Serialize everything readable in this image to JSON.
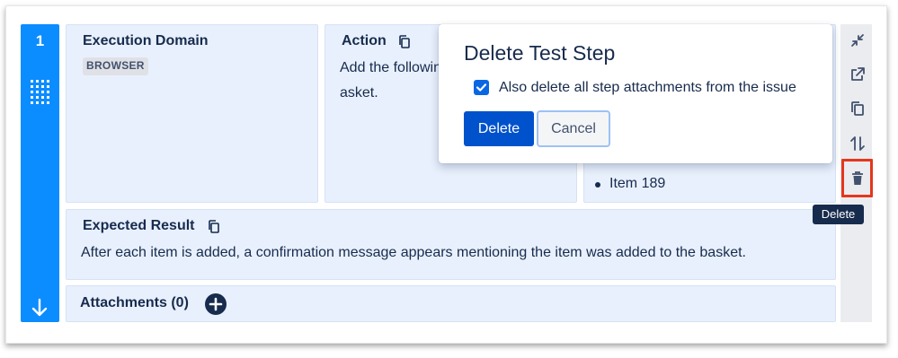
{
  "step": {
    "number": "1",
    "grid_icon": "grid-icon",
    "move_down_icon": "arrow-down-icon"
  },
  "execution_domain": {
    "title": "Execution Domain",
    "badge": "BROWSER"
  },
  "action": {
    "title": "Action",
    "text_line1": "Add the followin",
    "text_line2": "asket."
  },
  "data_panel": {
    "bullet_item": "Item 189"
  },
  "expected_result": {
    "title": "Expected Result",
    "text": "After each item is added, a confirmation message appears mentioning the item was added to the basket."
  },
  "attachments": {
    "title": "Attachments (0)",
    "add_icon": "plus-circle-icon"
  },
  "side_actions": [
    "collapse-icon",
    "open-external-icon",
    "copy-icon",
    "move-icon",
    "trash-icon"
  ],
  "tooltip": "Delete",
  "dialog": {
    "title": "Delete Test Step",
    "checkbox_checked": true,
    "checkbox_label": "Also delete all step attachments from the issue",
    "delete_label": "Delete",
    "cancel_label": "Cancel"
  },
  "colors": {
    "step_strip": "#0b8cff",
    "panel_bg": "#e8f0fd",
    "primary": "#0052cc",
    "highlight": "#e5361c"
  }
}
